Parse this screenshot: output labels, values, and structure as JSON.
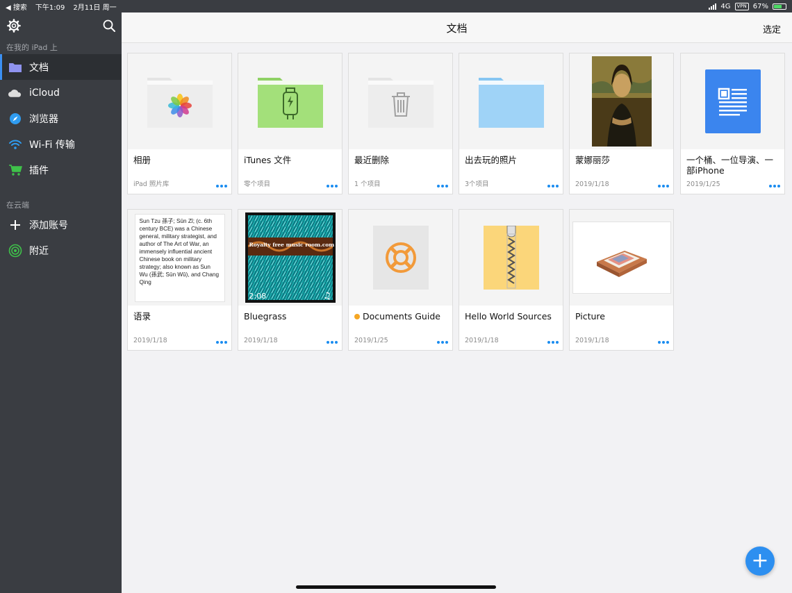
{
  "status": {
    "back": "◀ 搜索",
    "time": "下午1:09",
    "date": "2月11日 周一",
    "network": "4G",
    "vpn": "VPN",
    "battery": "67%"
  },
  "sidebar": {
    "section_local": "在我的 iPad 上",
    "items": [
      {
        "label": "文档",
        "icon": "folder-icon"
      },
      {
        "label": "iCloud",
        "icon": "cloud-icon"
      },
      {
        "label": "浏览器",
        "icon": "compass-icon"
      },
      {
        "label": "Wi-Fi 传输",
        "icon": "wifi-icon"
      },
      {
        "label": "插件",
        "icon": "cart-icon"
      }
    ],
    "section_cloud": "在云端",
    "cloud_items": [
      {
        "label": "添加账号",
        "icon": "plus-icon"
      },
      {
        "label": "附近",
        "icon": "nearby-icon"
      }
    ]
  },
  "topbar": {
    "title": "文档",
    "select": "选定"
  },
  "files": [
    {
      "name": "相册",
      "meta": "iPad 照片库"
    },
    {
      "name": "iTunes 文件",
      "meta": "零个项目"
    },
    {
      "name": "最近删除",
      "meta": "1 个项目"
    },
    {
      "name": "出去玩的照片",
      "meta": "3个项目"
    },
    {
      "name": "蒙娜丽莎",
      "meta": "2019/1/18"
    },
    {
      "name": "一个桶、一位导演、一部iPhone",
      "meta": "2019/1/25"
    },
    {
      "name": "语录",
      "meta": "2019/1/18",
      "preview": "Sun Tzu 孫子; Sūn Zǐ; (c. 6th century BCE) was a Chinese general, military strategist, and author of The Art of War, an immensely influential ancient Chinese book on military strategy; also known as Sun Wu (孫武; Sūn Wǔ), and Chang Qing"
    },
    {
      "name": "Bluegrass",
      "meta": "2019/1/18",
      "banner": "Royalty free music room.com",
      "duration": "2:08"
    },
    {
      "name": "Documents Guide",
      "meta": "2019/1/25"
    },
    {
      "name": "Hello World Sources",
      "meta": "2019/1/18"
    },
    {
      "name": "Picture",
      "meta": "2019/1/18"
    }
  ],
  "fab_label": "+",
  "colors": {
    "accent": "#1a8cf0",
    "sidebar": "#3a3d42",
    "itunes_folder": "#a3e07a",
    "photo_folder": "#9fd3f7"
  }
}
